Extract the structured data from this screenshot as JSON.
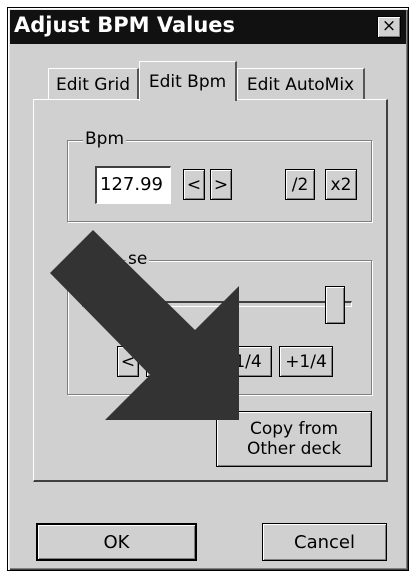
{
  "window": {
    "title": "Adjust BPM Values",
    "close_glyph": "×"
  },
  "tabs": [
    {
      "label": "Edit Grid"
    },
    {
      "label": "Edit Bpm",
      "active": true
    },
    {
      "label": "Edit AutoMix"
    }
  ],
  "bpm_group": {
    "label": "Bpm",
    "value": "127.99",
    "dec_label": "<",
    "inc_label": ">",
    "half_label": "/2",
    "double_label": "x2"
  },
  "phase_group": {
    "label_visible": "se",
    "slider_level": 0.97,
    "btn_prev": "<",
    "btn_minus_quarter": "1/4",
    "btn_plus_quarter": "+1/4"
  },
  "copy_button": {
    "line1": "Copy from",
    "line2": "Other deck"
  },
  "footer": {
    "ok_label": "OK",
    "cancel_label": "Cancel"
  },
  "overlay": {
    "icon": "big-arrow-icon",
    "color": "#333333"
  }
}
